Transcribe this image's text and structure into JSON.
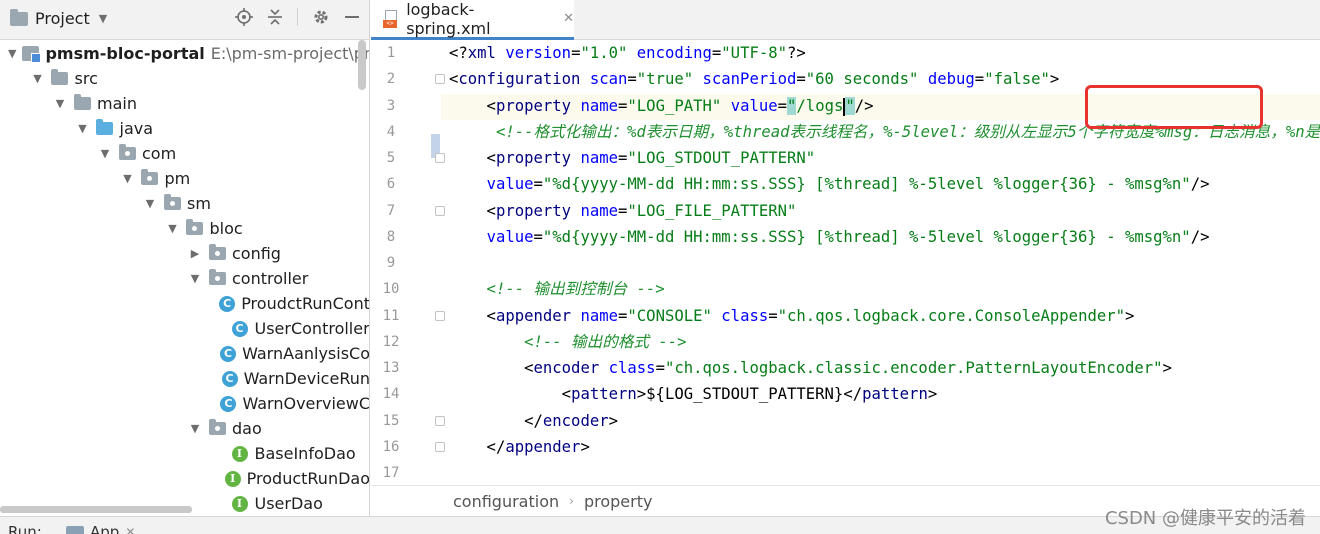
{
  "project_panel": {
    "title": "Project",
    "tree": [
      {
        "label": "pmsm-bloc-portal",
        "path": "E:\\pm-sm-project\\pmsm",
        "bold": true,
        "depth": 0,
        "expanded": true,
        "icon": "module-icon"
      },
      {
        "label": "src",
        "depth": 1,
        "expanded": true,
        "icon": "folder-icon"
      },
      {
        "label": "main",
        "depth": 2,
        "expanded": true,
        "icon": "folder-icon"
      },
      {
        "label": "java",
        "depth": 3,
        "expanded": true,
        "icon": "source-folder-icon"
      },
      {
        "label": "com",
        "depth": 4,
        "expanded": true,
        "icon": "package-icon"
      },
      {
        "label": "pm",
        "depth": 5,
        "expanded": true,
        "icon": "package-icon"
      },
      {
        "label": "sm",
        "depth": 6,
        "expanded": true,
        "icon": "package-icon"
      },
      {
        "label": "bloc",
        "depth": 7,
        "expanded": true,
        "icon": "package-icon"
      },
      {
        "label": "config",
        "depth": 8,
        "expanded": false,
        "icon": "package-icon"
      },
      {
        "label": "controller",
        "depth": 8,
        "expanded": true,
        "icon": "package-icon"
      },
      {
        "label": "ProudctRunCont",
        "depth": 9,
        "leaf": true,
        "icon": "class-icon"
      },
      {
        "label": "UserController",
        "depth": 9,
        "leaf": true,
        "icon": "class-icon"
      },
      {
        "label": "WarnAanlysisCo",
        "depth": 9,
        "leaf": true,
        "icon": "class-icon"
      },
      {
        "label": "WarnDeviceRun",
        "depth": 9,
        "leaf": true,
        "icon": "class-icon"
      },
      {
        "label": "WarnOverviewC",
        "depth": 9,
        "leaf": true,
        "icon": "class-icon"
      },
      {
        "label": "dao",
        "depth": 8,
        "expanded": true,
        "icon": "package-icon"
      },
      {
        "label": "BaseInfoDao",
        "depth": 9,
        "leaf": true,
        "icon": "interface-icon"
      },
      {
        "label": "ProductRunDao",
        "depth": 9,
        "leaf": true,
        "icon": "interface-icon"
      },
      {
        "label": "UserDao",
        "depth": 9,
        "leaf": true,
        "icon": "interface-icon"
      }
    ]
  },
  "editor": {
    "tab_label": "logback-spring.xml",
    "line_numbers": [
      "1",
      "2",
      "3",
      "4",
      "5",
      "6",
      "7",
      "8",
      "9",
      "10",
      "11",
      "12",
      "13",
      "14",
      "15",
      "16",
      "17"
    ],
    "breadcrumbs": [
      "configuration",
      "property"
    ]
  },
  "run_bar": {
    "run_label": "Run:",
    "app_label": "App"
  },
  "watermark": "CSDN @健康平安的活着",
  "colors": {
    "accent_tab": "#4083c9",
    "highlight_box": "#e8322d",
    "xml_tag": "#000080",
    "xml_attr": "#0000ff",
    "xml_value": "#067d17"
  }
}
